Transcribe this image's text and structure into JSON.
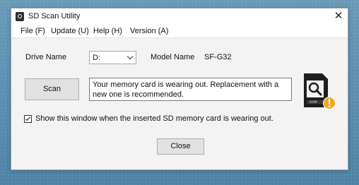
{
  "window": {
    "title": "SD Scan Utility",
    "close_glyph": "✕"
  },
  "menu": {
    "items": [
      {
        "label": "File (F)"
      },
      {
        "label": "Update (U)"
      },
      {
        "label": "Help (H)"
      },
      {
        "label": "Version (A)"
      }
    ]
  },
  "drive": {
    "label": "Drive Name",
    "selected": "D:"
  },
  "model": {
    "label": "Model Name",
    "value": "SF-G32"
  },
  "scan": {
    "button_label": "Scan",
    "message": "Your memory card is wearing out. Replacement with a new one is recommended."
  },
  "card_icon": {
    "brand": "SONY",
    "icons": [
      "sd-card-icon",
      "magnifier-icon",
      "warning-icon"
    ],
    "colors": {
      "card": "#1e1e1e",
      "warning": "#f5a623"
    }
  },
  "option": {
    "checked": true,
    "label": "Show this window when the inserted SD memory card is wearing out."
  },
  "footer": {
    "close_label": "Close"
  }
}
